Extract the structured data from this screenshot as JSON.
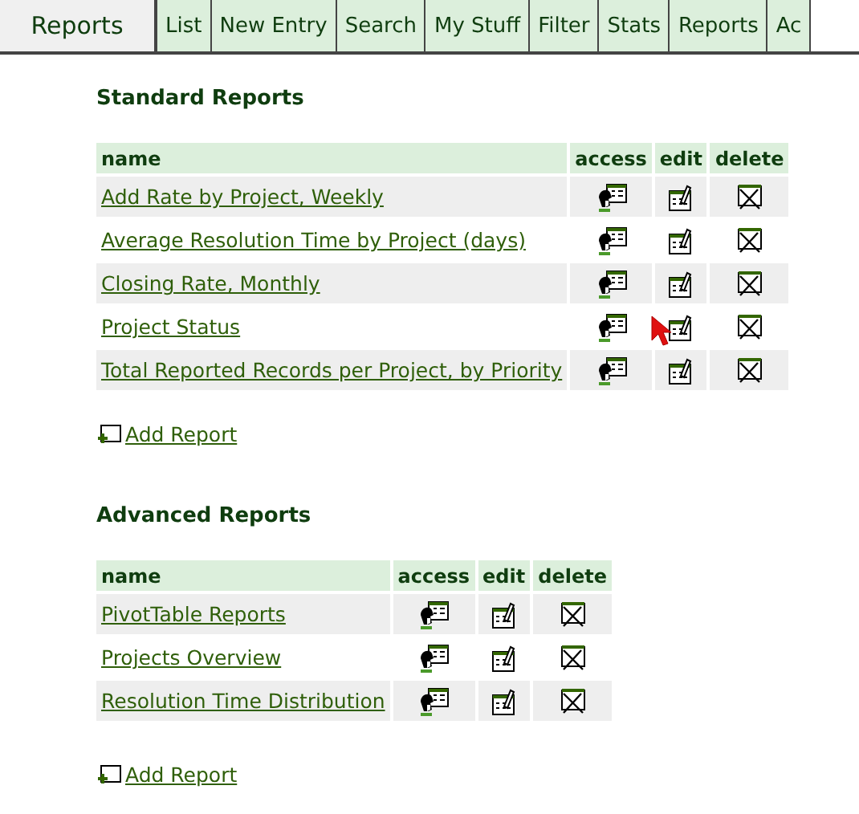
{
  "header": {
    "title": "Reports",
    "tabs": [
      {
        "label": "List"
      },
      {
        "label": "New Entry"
      },
      {
        "label": "Search"
      },
      {
        "label": "My Stuff"
      },
      {
        "label": "Filter"
      },
      {
        "label": "Stats"
      },
      {
        "label": "Reports"
      },
      {
        "label": "Ac"
      }
    ]
  },
  "sections": [
    {
      "heading": "Standard Reports",
      "columns": [
        "name",
        "access",
        "edit",
        "delete"
      ],
      "rows": [
        {
          "name": "Add Rate by Project, Weekly"
        },
        {
          "name": "Average Resolution Time by Project (days)"
        },
        {
          "name": "Closing Rate, Monthly"
        },
        {
          "name": "Project Status"
        },
        {
          "name": "Total Reported Records per Project, by Priority"
        }
      ],
      "add_link": "Add Report"
    },
    {
      "heading": "Advanced Reports",
      "columns": [
        "name",
        "access",
        "edit",
        "delete"
      ],
      "rows": [
        {
          "name": "PivotTable Reports"
        },
        {
          "name": "Projects Overview"
        },
        {
          "name": "Resolution Time Distribution"
        }
      ],
      "add_link": "Add Report"
    }
  ]
}
